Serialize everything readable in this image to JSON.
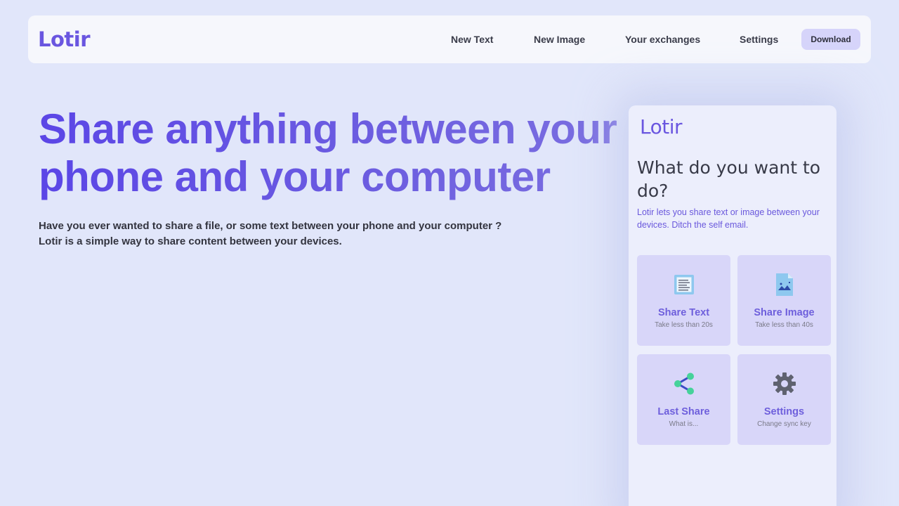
{
  "nav": {
    "logo": "Lotir",
    "links": [
      "New Text",
      "New Image",
      "Your exchanges",
      "Settings"
    ],
    "download_label": "Download"
  },
  "hero": {
    "title": "Share anything between your phone and your computer",
    "desc_line1": "Have you ever wanted to share a file, or some text between your phone and your computer ?",
    "desc_line2": "Lotir is a simple way to share content between your devices."
  },
  "phone": {
    "logo": "Lotir",
    "title": "What do you want to do?",
    "subtitle": "Lotir lets you share text or image between your devices. Ditch the self email.",
    "tiles": [
      {
        "icon": "document-text-icon",
        "title": "Share Text",
        "subtitle": "Take less than 20s"
      },
      {
        "icon": "image-file-icon",
        "title": "Share Image",
        "subtitle": "Take less than 40s"
      },
      {
        "icon": "share-icon",
        "title": "Last Share",
        "subtitle": "What is..."
      },
      {
        "icon": "gear-icon",
        "title": "Settings",
        "subtitle": "Change sync key"
      }
    ]
  },
  "colors": {
    "background": "#e1e6fa",
    "accent": "#6a56e0",
    "tile_background": "#d8d6f9",
    "download_button": "#d6d4fa"
  }
}
